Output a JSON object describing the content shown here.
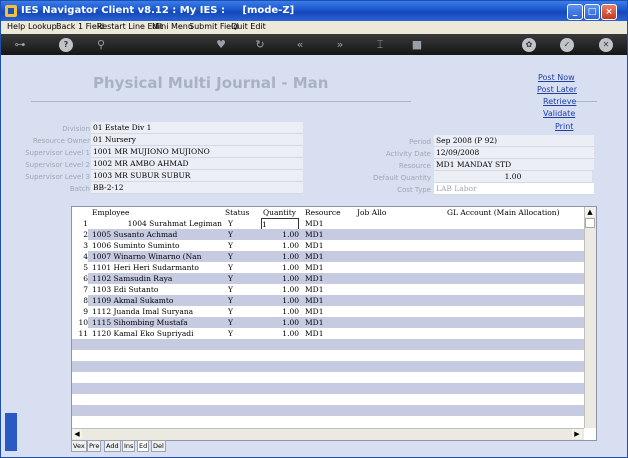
{
  "window": {
    "title": "IES Navigator Client v8.12 : My IES :     [mode-Z]"
  },
  "menu": [
    "Help",
    "Lookup",
    "Back 1 Field",
    "Restart Line Edit",
    "Mini Menu",
    "Submit Field",
    "Quit Edit"
  ],
  "toolbar": {
    "icons": [
      "key-icon",
      "help-icon",
      "search-icon",
      "heart-icon",
      "refresh-icon",
      "rewind-icon",
      "forward-icon",
      "pin-icon",
      "stop-icon",
      "settings-icon",
      "check-icon",
      "close-icon"
    ],
    "glyphs": [
      "⊶",
      "?",
      "⚲",
      "♥",
      "↻",
      "«",
      "»",
      "⌶",
      "■",
      "✿",
      "✓",
      "✕"
    ]
  },
  "page": {
    "title": "Physical Multi Journal - Man"
  },
  "actions": [
    "Post Now",
    "Post Later",
    "Retrieve",
    "Validate",
    "Print"
  ],
  "form_left": [
    {
      "label": "Division",
      "value": "01 Estate Div 1"
    },
    {
      "label": "Resource Owner",
      "value": "01 Nursery"
    },
    {
      "label": "Supervisor Level 1",
      "value": "1001 MR MUJIONO MUJIONO"
    },
    {
      "label": "Supervisor Level 2",
      "value": "1002 MR AMBO AHMAD"
    },
    {
      "label": "Supervisor Level 3",
      "value": "1003 MR SUBUR SUBUR"
    },
    {
      "label": "Batch",
      "value": "BB-2-12"
    }
  ],
  "form_right": [
    {
      "label": "Period",
      "value": "Sep 2008 (P 92)"
    },
    {
      "label": "Activity Date",
      "value": "12/09/2008"
    },
    {
      "label": "Resource",
      "value": "MD1 MANDAY STD"
    },
    {
      "label": "Default Quantity",
      "value": "1.00"
    },
    {
      "label": "Cost Type",
      "value": "LAB Labor"
    }
  ],
  "grid": {
    "columns": [
      "Employee",
      "Status",
      "Quantity",
      "Resource",
      "Job Allo",
      "GL Account (Main Allocation)"
    ],
    "rows": [
      {
        "n": "1",
        "employee": "1004 Surahmat Legiman",
        "status": "Y",
        "quantity": "1",
        "resource": "MD1"
      },
      {
        "n": "2",
        "employee": "1005 Susanto Achmad",
        "status": "Y",
        "quantity": "1.00",
        "resource": "MD1"
      },
      {
        "n": "3",
        "employee": "1006 Suminto Suminto",
        "status": "Y",
        "quantity": "1.00",
        "resource": "MD1"
      },
      {
        "n": "4",
        "employee": "1007 Winarno Winarno (Nan",
        "status": "Y",
        "quantity": "1.00",
        "resource": "MD1"
      },
      {
        "n": "5",
        "employee": "1101 Heri Heri Sudarmanto",
        "status": "Y",
        "quantity": "1.00",
        "resource": "MD1"
      },
      {
        "n": "6",
        "employee": "1102 Samsudin Raya",
        "status": "Y",
        "quantity": "1.00",
        "resource": "MD1"
      },
      {
        "n": "7",
        "employee": "1103 Edi Sutanto",
        "status": "Y",
        "quantity": "1.00",
        "resource": "MD1"
      },
      {
        "n": "8",
        "employee": "1109 Akmal Sukamto",
        "status": "Y",
        "quantity": "1.00",
        "resource": "MD1"
      },
      {
        "n": "9",
        "employee": "1112 Juanda Imal Suryana",
        "status": "Y",
        "quantity": "1.00",
        "resource": "MD1"
      },
      {
        "n": "10",
        "employee": "1115 Sihombing Mustafa",
        "status": "Y",
        "quantity": "1.00",
        "resource": "MD1"
      },
      {
        "n": "11",
        "employee": "1120 Kamal Eko Supriyadi",
        "status": "Y",
        "quantity": "1.00",
        "resource": "MD1"
      }
    ]
  },
  "tabs": [
    "Vex",
    "Pre",
    "Add",
    "Ins",
    "Ed",
    "Del"
  ],
  "active_tab": "Ed",
  "colors": {
    "link": "#1f3fa8",
    "row_alt": "#c6cbe2",
    "title_grey": "#a9b1c4"
  }
}
